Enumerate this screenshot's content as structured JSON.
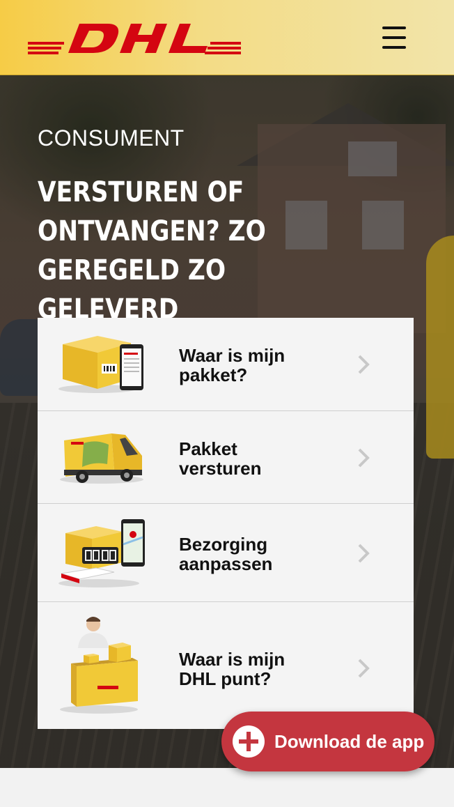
{
  "header": {
    "logo_text": "DHL",
    "menu_icon": "hamburger-menu-icon"
  },
  "hero": {
    "eyebrow": "CONSUMENT",
    "title_lines": [
      "VERSTUREN OF",
      "ONTVANGEN? ZO",
      "GEREGELD ZO GELEVERD"
    ]
  },
  "cards": [
    {
      "label_lines": [
        "Waar is mijn",
        "pakket?"
      ],
      "icon": "parcel-phone-tracking-icon"
    },
    {
      "label_lines": [
        "Pakket",
        "versturen"
      ],
      "icon": "delivery-van-icon"
    },
    {
      "label_lines": [
        "Bezorging",
        "aanpassen"
      ],
      "icon": "parcel-clock-calendar-icon"
    },
    {
      "label_lines": [
        "Waar is mijn",
        "DHL punt?"
      ],
      "icon": "service-point-counter-icon"
    }
  ],
  "download": {
    "label": "Download de app",
    "icon": "plus-circle-icon"
  },
  "colors": {
    "brand_yellow": "#FFCC00",
    "brand_red": "#D40511",
    "button_red": "#C4363F"
  }
}
